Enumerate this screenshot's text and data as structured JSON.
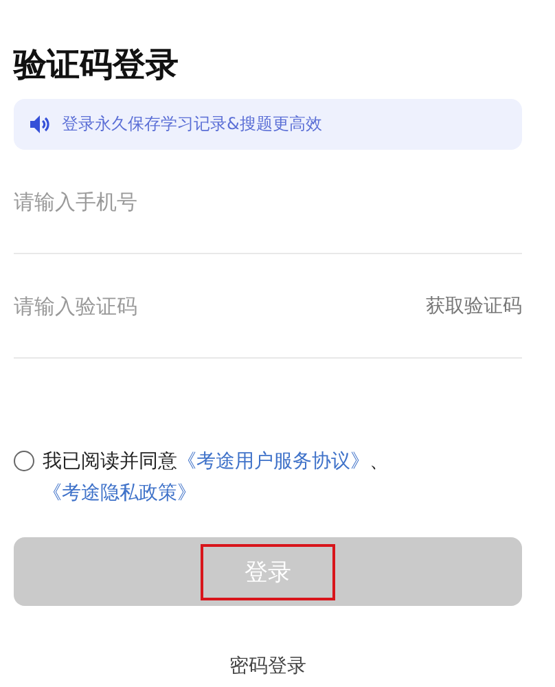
{
  "title": "验证码登录",
  "banner": {
    "text": "登录永久保存学习记录&搜题更高效"
  },
  "fields": [
    {
      "placeholder": "请输入手机号"
    },
    {
      "placeholder": "请输入验证码",
      "action": "获取验证码"
    }
  ],
  "agreement": {
    "checked": false,
    "text": "我已阅读并同意",
    "links": [
      "《考途用户服务协议》",
      "《考途隐私政策》"
    ],
    "separator": "、"
  },
  "login_button": {
    "label": "登录",
    "enabled": false,
    "highlighted": true
  },
  "alt_login": "密码登录"
}
